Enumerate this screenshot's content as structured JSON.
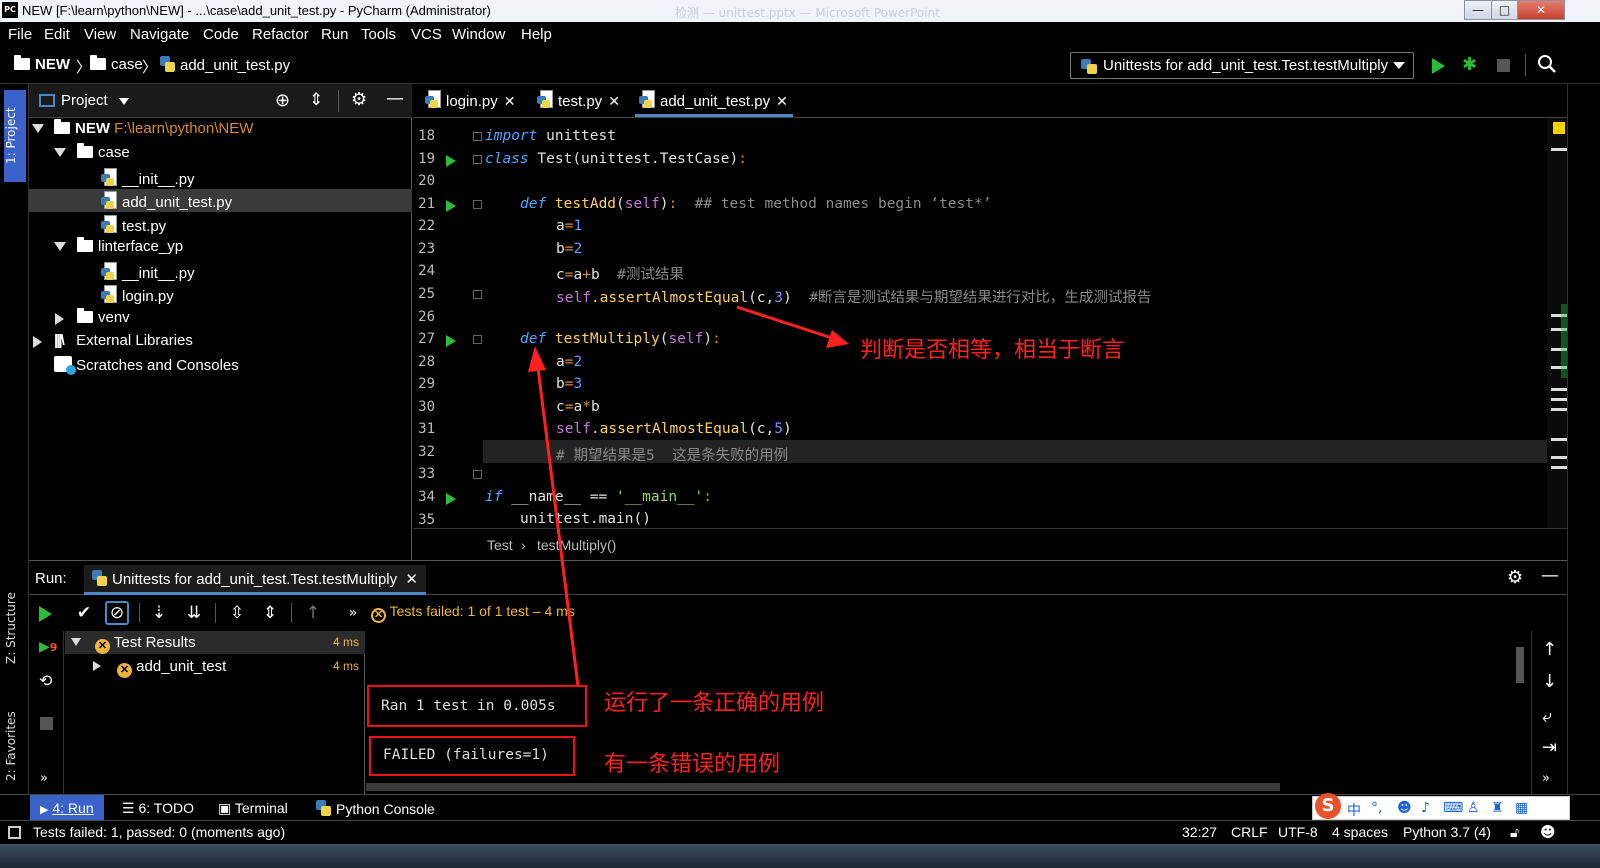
{
  "window": {
    "title": "NEW [F:\\learn\\python\\NEW] - ...\\case\\add_unit_test.py - PyCharm (Administrator)",
    "app_icon": "PC",
    "background_window_title": "检测 — unittest.pptx — Microsoft PowerPoint",
    "controls": {
      "minimize": "—",
      "maximize": "□",
      "close": "✕"
    }
  },
  "menu": [
    "File",
    "Edit",
    "View",
    "Navigate",
    "Code",
    "Refactor",
    "Run",
    "Tools",
    "VCS",
    "Window",
    "Help"
  ],
  "breadcrumb": [
    "NEW",
    "case",
    "add_unit_test.py"
  ],
  "run_config": {
    "label": "Unittests for add_unit_test.Test.testMultiply"
  },
  "left_strip": {
    "project_tab": "1: Project",
    "structure_tab": "Z: Structure",
    "favorites_tab": "2: Favorites"
  },
  "project_panel": {
    "title": "Project",
    "tree": [
      {
        "label": "NEW",
        "path": "F:\\learn\\python\\NEW"
      },
      {
        "label": "case"
      },
      {
        "label": "__init__.py"
      },
      {
        "label": "add_unit_test.py"
      },
      {
        "label": "test.py"
      },
      {
        "label": "linterface_yp"
      },
      {
        "label": "__init__.py"
      },
      {
        "label": "login.py"
      },
      {
        "label": "venv"
      },
      {
        "label": "External Libraries"
      },
      {
        "label": "Scratches and Consoles"
      }
    ]
  },
  "editor": {
    "tabs": [
      "login.py",
      "test.py",
      "add_unit_test.py"
    ],
    "active_tab": "add_unit_test.py",
    "line_numbers": [
      "18",
      "19",
      "20",
      "21",
      "22",
      "23",
      "24",
      "25",
      "26",
      "27",
      "28",
      "29",
      "30",
      "31",
      "32",
      "33",
      "34",
      "35"
    ],
    "code": {
      "l18_kw": "import",
      "l18_rest": " unittest",
      "l19_kw": "class",
      "l19_name": " Test",
      "l19_rest": "(unittest.TestCase)",
      "l21_kw": "def",
      "l21_fn": " testAdd",
      "l21_self": "self",
      "l21_cm": "## test method names begin ‘test*’",
      "l22_var": "a",
      "l22_num": "1",
      "l23_var": "b",
      "l23_num": "2",
      "l24_lhs": "c",
      "l24_rhs": "a",
      "l24_rhs2": "b",
      "l24_cm": "#测试结果",
      "l25_self": "self",
      "l25_call": ".assertAlmostEqual",
      "l25_args": "(c,",
      "l25_num": "3",
      "l25_close": ")",
      "l25_cm": "#断言是测试结果与期望结果进行对比，生成测试报告",
      "l27_kw": "def",
      "l27_fn": " testMultiply",
      "l27_self": "self",
      "l28_var": "a",
      "l28_num": "2",
      "l29_var": "b",
      "l29_num": "3",
      "l30_lhs": "c",
      "l30_rhs": "a",
      "l30_rhs2": "b",
      "l31_self": "self",
      "l31_call": ".assertAlmostEqual",
      "l31_args": "(c,",
      "l31_num": "5",
      "l31_close": ")",
      "l32_cm": "# 期望结果是5  这是条失败的用例",
      "l34_kw": "if",
      "l34_rest": " __name__ == ",
      "l34_str": "'__main__'",
      "l35": "unittest.main()"
    },
    "footer_breadcrumb": [
      "Test",
      "testMultiply()"
    ]
  },
  "run_panel": {
    "label": "Run:",
    "tab": "Unittests for add_unit_test.Test.testMultiply",
    "status": "Tests failed: 1 of 1 test – 4 ms",
    "tree": [
      {
        "label": "Test Results",
        "duration": "4 ms"
      },
      {
        "label": "add_unit_test",
        "duration": "4 ms"
      }
    ],
    "console": {
      "ran": "Ran 1 test in 0.005s",
      "failed": "FAILED (failures=1)"
    }
  },
  "annotations": {
    "assert_note": "判断是否相等，相当于断言",
    "ran_note": "运行了一条正确的用例",
    "failed_note": "有一条错误的用例",
    "color": "#ff2020"
  },
  "bottom_tools": [
    "4: Run",
    "6: TODO",
    "Terminal",
    "Python Console"
  ],
  "status_bar": {
    "message": "Tests failed: 1, passed: 0 (moments ago)",
    "position": "32:27",
    "line_sep": "CRLF",
    "encoding": "UTF-8",
    "indent": "4 spaces",
    "interpreter": "Python 3.7 (4)"
  },
  "ime": {
    "logo": "S",
    "mode": "中"
  },
  "colors": {
    "accent": "#3a62c8",
    "run_green": "#2bbd3a",
    "fail_yellow": "#f0b43a",
    "keyword": "#4fa6ff"
  }
}
